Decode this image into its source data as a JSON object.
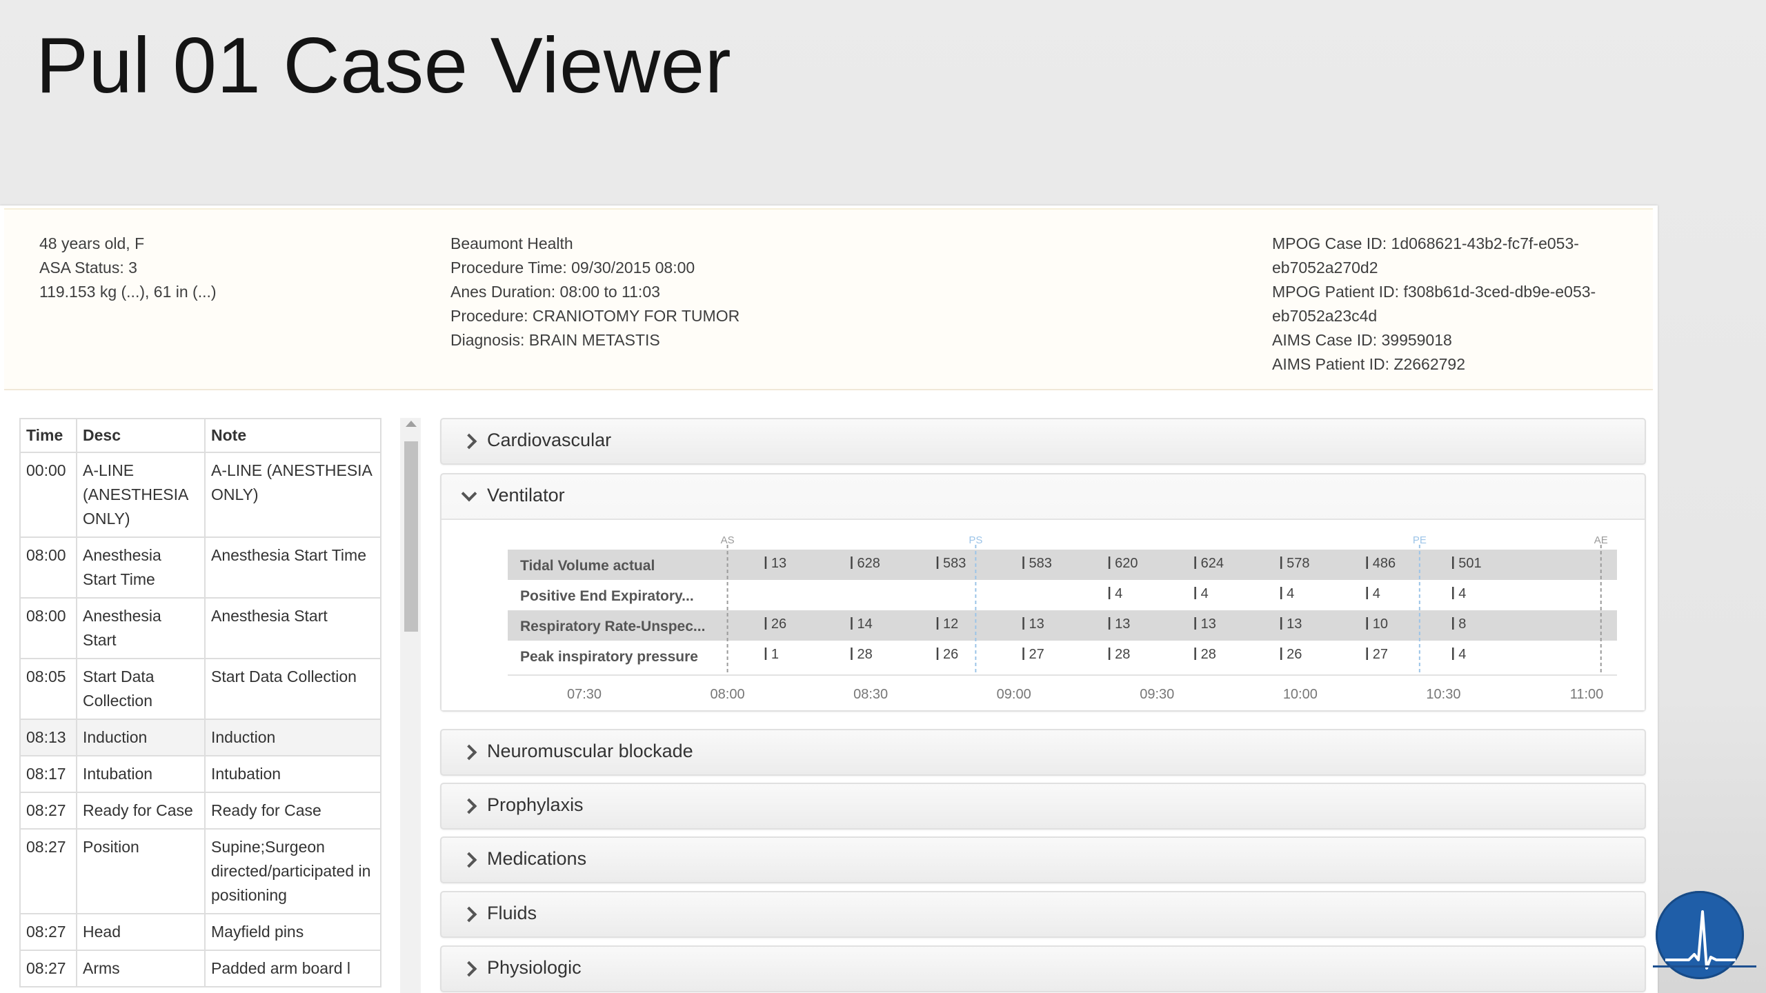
{
  "title": "Pul 01 Case Viewer",
  "patient": {
    "age_sex": "48 years old, F",
    "asa": "ASA Status: 3",
    "weight_height": "119.153 kg (...), 61 in (...)"
  },
  "procedure": {
    "facility": "Beaumont Health",
    "procedure_time": "Procedure Time: 09/30/2015 08:00",
    "anes_duration": "Anes Duration: 08:00 to 11:03",
    "procedure": "Procedure: CRANIOTOMY FOR TUMOR",
    "diagnosis": "Diagnosis: BRAIN METASTIS"
  },
  "ids": {
    "mpog_case_1": "MPOG Case ID: 1d068621-43b2-fc7f-e053-",
    "mpog_case_2": "eb7052a270d2",
    "mpog_patient_1": "MPOG Patient ID: f308b61d-3ced-db9e-e053-",
    "mpog_patient_2": "eb7052a23c4d",
    "aims_case": "AIMS Case ID: 39959018",
    "aims_patient": "AIMS Patient ID: Z2662792"
  },
  "events": {
    "headers": {
      "time": "Time",
      "desc": "Desc",
      "note": "Note"
    },
    "rows": [
      {
        "time": "00:00",
        "desc": "A-LINE (ANESTHESIA ONLY)",
        "note": "A-LINE (ANESTHESIA ONLY)"
      },
      {
        "time": "08:00",
        "desc": "Anesthesia Start Time",
        "note": "Anesthesia Start Time"
      },
      {
        "time": "08:00",
        "desc": "Anesthesia Start",
        "note": "Anesthesia Start"
      },
      {
        "time": "08:05",
        "desc": "Start Data Collection",
        "note": "Start Data Collection"
      },
      {
        "time": "08:13",
        "desc": "Induction",
        "note": "Induction"
      },
      {
        "time": "08:17",
        "desc": "Intubation",
        "note": "Intubation"
      },
      {
        "time": "08:27",
        "desc": "Ready for Case",
        "note": "Ready for Case"
      },
      {
        "time": "08:27",
        "desc": "Position",
        "note": "Supine;Surgeon directed/participated in positioning"
      },
      {
        "time": "08:27",
        "desc": "Head",
        "note": "Mayfield pins"
      },
      {
        "time": "08:27",
        "desc": "Arms",
        "note": "Padded arm board l"
      }
    ]
  },
  "sections": {
    "cardiovascular": "Cardiovascular",
    "ventilator": "Ventilator",
    "neuromuscular": "Neuromuscular blockade",
    "prophylaxis": "Prophylaxis",
    "medications": "Medications",
    "fluids": "Fluids",
    "physiologic": "Physiologic"
  },
  "chart_data": {
    "type": "table",
    "markers": [
      {
        "label": "AS",
        "time": "08:00",
        "color": "#9a9a9a"
      },
      {
        "label": "PS",
        "time": "08:52",
        "color": "#9cc4e8"
      },
      {
        "label": "PE",
        "time": "10:25",
        "color": "#9cc4e8"
      },
      {
        "label": "AE",
        "time": "11:03",
        "color": "#9a9a9a"
      }
    ],
    "x_ticks": [
      "07:30",
      "08:00",
      "08:30",
      "09:00",
      "09:30",
      "10:00",
      "10:30",
      "11:00"
    ],
    "xlim": [
      "07:30",
      "11:00"
    ],
    "rows": [
      {
        "name": "Tidal Volume actual",
        "shaded": true,
        "values": [
          {
            "t": "08:08",
            "v": "13"
          },
          {
            "t": "08:26",
            "v": "628"
          },
          {
            "t": "08:44",
            "v": "583"
          },
          {
            "t": "09:02",
            "v": "583"
          },
          {
            "t": "09:20",
            "v": "620"
          },
          {
            "t": "09:38",
            "v": "624"
          },
          {
            "t": "09:56",
            "v": "578"
          },
          {
            "t": "10:14",
            "v": "486"
          },
          {
            "t": "10:32",
            "v": "501"
          }
        ]
      },
      {
        "name": "Positive End Expiratory...",
        "shaded": false,
        "values": [
          {
            "t": "09:20",
            "v": "4"
          },
          {
            "t": "09:38",
            "v": "4"
          },
          {
            "t": "09:56",
            "v": "4"
          },
          {
            "t": "10:14",
            "v": "4"
          },
          {
            "t": "10:32",
            "v": "4"
          }
        ]
      },
      {
        "name": "Respiratory Rate-Unspec...",
        "shaded": true,
        "values": [
          {
            "t": "08:08",
            "v": "26"
          },
          {
            "t": "08:26",
            "v": "14"
          },
          {
            "t": "08:44",
            "v": "12"
          },
          {
            "t": "09:02",
            "v": "13"
          },
          {
            "t": "09:20",
            "v": "13"
          },
          {
            "t": "09:38",
            "v": "13"
          },
          {
            "t": "09:56",
            "v": "13"
          },
          {
            "t": "10:14",
            "v": "10"
          },
          {
            "t": "10:32",
            "v": "8"
          }
        ]
      },
      {
        "name": "Peak inspiratory pressure",
        "shaded": false,
        "values": [
          {
            "t": "08:08",
            "v": "1"
          },
          {
            "t": "08:26",
            "v": "28"
          },
          {
            "t": "08:44",
            "v": "26"
          },
          {
            "t": "09:02",
            "v": "27"
          },
          {
            "t": "09:20",
            "v": "28"
          },
          {
            "t": "09:38",
            "v": "28"
          },
          {
            "t": "09:56",
            "v": "26"
          },
          {
            "t": "10:14",
            "v": "27"
          },
          {
            "t": "10:32",
            "v": "4"
          }
        ]
      }
    ]
  },
  "colors": {
    "logo": "#1f5ea8",
    "row_shade": "#d9d9d9"
  }
}
